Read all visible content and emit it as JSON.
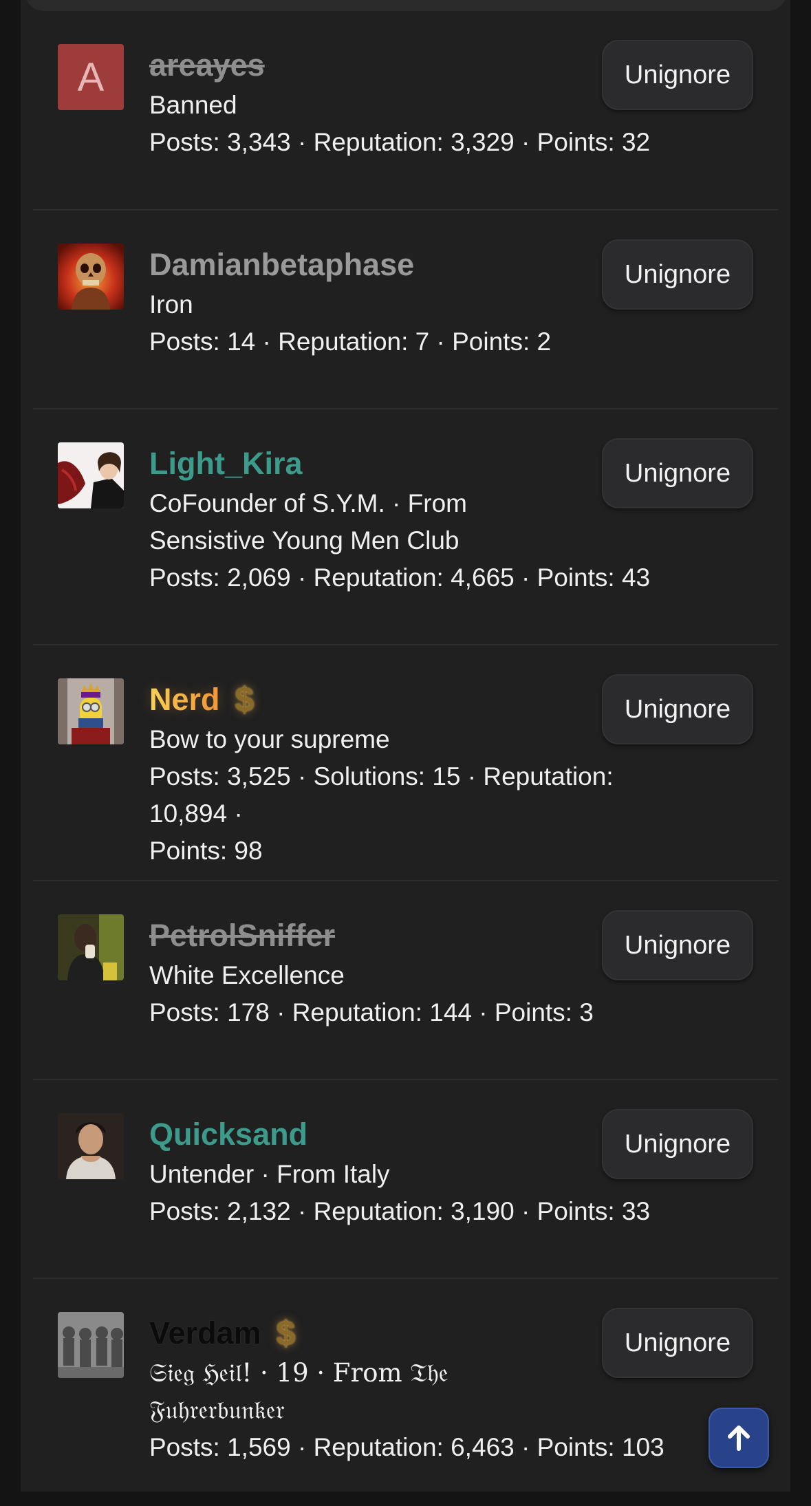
{
  "button_label": "Unignore",
  "members": [
    {
      "username": "areayes",
      "avatar": {
        "type": "letter",
        "letter": "A",
        "icon": "letter-avatar"
      },
      "title": "Banned",
      "stats": "Posts: 3,343 · Reputation: 3,329 · Points: 32",
      "style": "banned"
    },
    {
      "username": "Damianbetaphase",
      "avatar": {
        "type": "image",
        "icon": "skull-avatar"
      },
      "title": "Iron",
      "stats": "Posts: 14 · Reputation: 7 · Points: 2",
      "style": "iron"
    },
    {
      "username": "Light_Kira",
      "avatar": {
        "type": "image",
        "icon": "anime-character-avatar"
      },
      "title_lines": [
        "CoFounder of S.Y.M. · From",
        "Sensistive Young Men Club"
      ],
      "stats": "Posts: 2,069 · Reputation: 4,665 · Points: 43",
      "style": "teal"
    },
    {
      "username": "Nerd",
      "avatar": {
        "type": "image",
        "icon": "minion-king-avatar"
      },
      "badge": "$",
      "title": "Bow to your supreme",
      "stats_lines": [
        "Posts: 3,525 · Solutions: 15 · Reputation: 10,894 ·",
        "Points: 98"
      ],
      "style": "gold"
    },
    {
      "username": "PetrolSniffer",
      "avatar": {
        "type": "image",
        "icon": "person-photo-avatar"
      },
      "title": "White Excellence",
      "stats": "Posts: 178 · Reputation: 144 · Points: 3",
      "style": "banned"
    },
    {
      "username": "Quicksand",
      "avatar": {
        "type": "image",
        "icon": "person-photo-avatar"
      },
      "title": "Untender · From Italy",
      "stats": "Posts: 2,132 · Reputation: 3,190 · Points: 33",
      "style": "teal"
    },
    {
      "username": "Verdam",
      "avatar": {
        "type": "image",
        "icon": "soldiers-photo-avatar"
      },
      "badge": "$",
      "title_lines": [
        "𝔖𝔦𝔢𝔤 ℌ𝔢𝔦𝔩! · 19 · From 𝔗𝔥𝔢",
        "𝔉𝔲𝔥𝔯𝔢𝔯𝔟𝔲𝔫𝔨𝔢𝔯"
      ],
      "stats": "Posts: 1,569 · Reputation: 6,463 · Points: 103",
      "style": "dark"
    }
  ],
  "scroll_top": {
    "icon": "arrow-up-icon",
    "color": "#28438a"
  },
  "colors": {
    "background": "#202021",
    "teal": "#3d9b8c",
    "gold_start": "#f7d55a",
    "gold_end": "#f29a3c",
    "banned_red": "#9e3b3b"
  }
}
